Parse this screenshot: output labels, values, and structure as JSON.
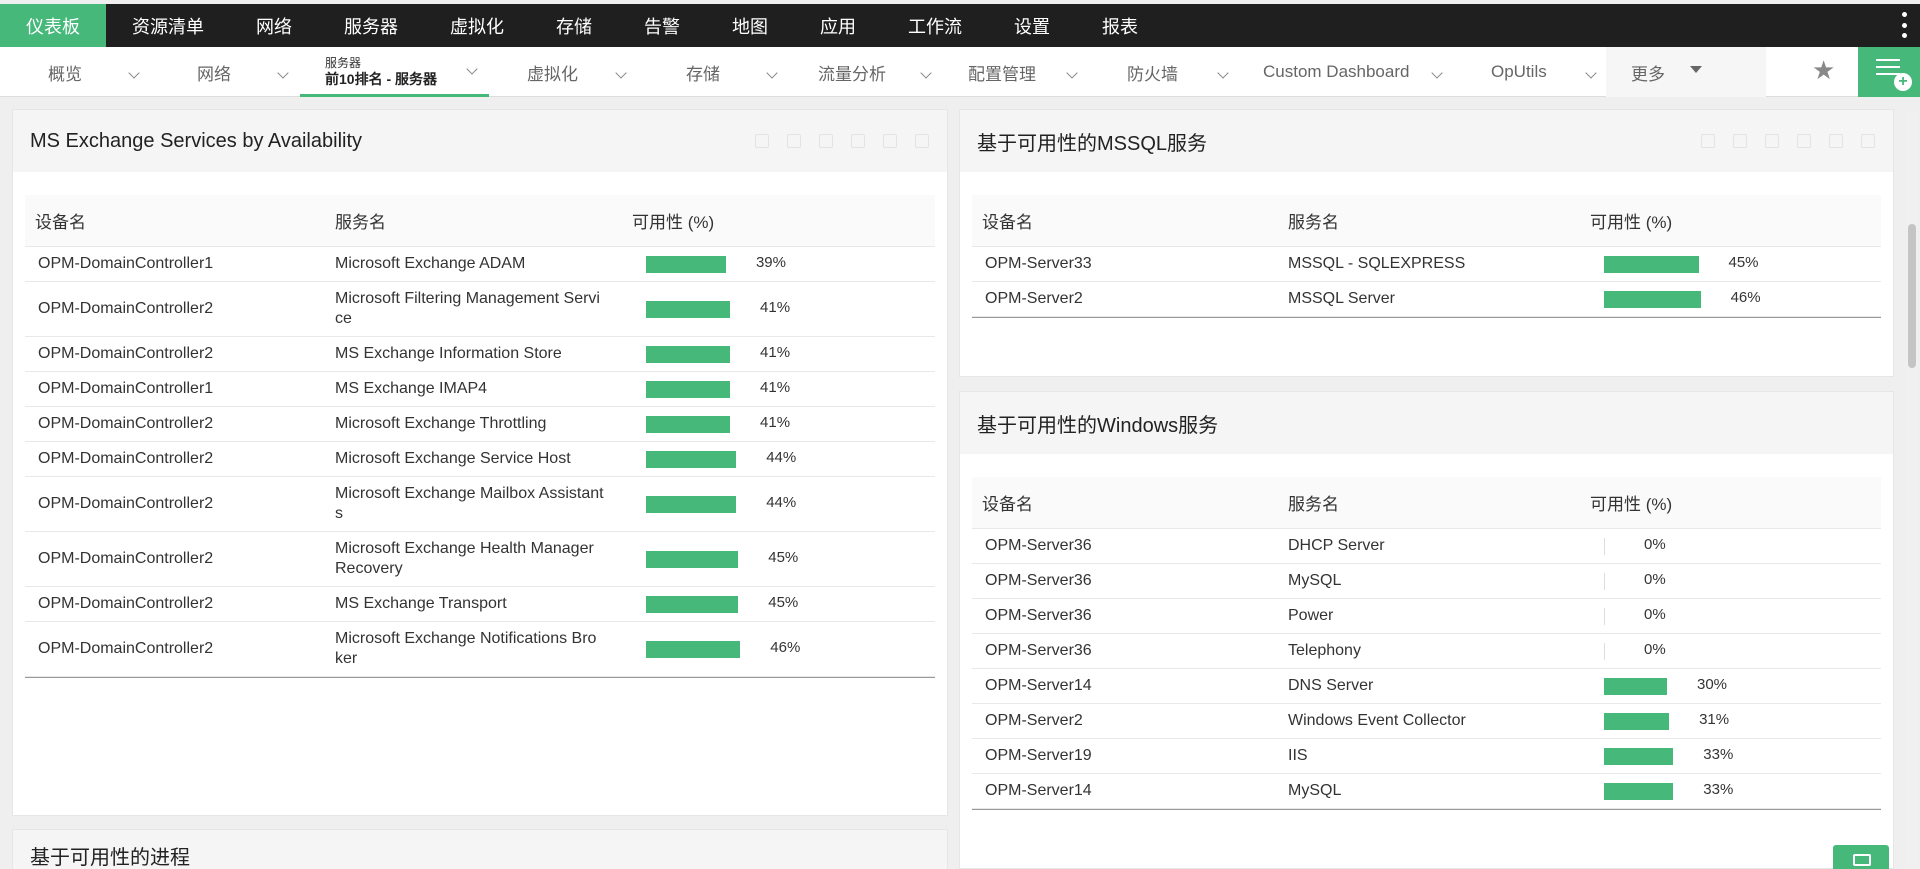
{
  "topnav": {
    "items": [
      "仪表板",
      "资源清单",
      "网络",
      "服务器",
      "虚拟化",
      "存储",
      "告警",
      "地图",
      "应用",
      "工作流",
      "设置",
      "报表"
    ]
  },
  "subnav": {
    "tabs": [
      "概览",
      "网络",
      "虚拟化",
      "存储",
      "流量分析",
      "配置管理",
      "防火墙",
      "Custom Dashboard",
      "OpUtils",
      "更多"
    ],
    "active_small": "服务器",
    "active_big": "前10排名 - 服务器"
  },
  "exchange": {
    "title": "MS Exchange Services by Availability",
    "headers": [
      "设备名",
      "服务名",
      "可用性 (%)"
    ],
    "rows": [
      {
        "device": "OPM-DomainController1",
        "service": "Microsoft Exchange ADAM",
        "service2": "",
        "value": 39,
        "pct": "39%"
      },
      {
        "device": "OPM-DomainController2",
        "service": "Microsoft Filtering Management Servi",
        "service2": "ce",
        "value": 41,
        "pct": "41%"
      },
      {
        "device": "OPM-DomainController2",
        "service": "MS Exchange Information Store",
        "service2": "",
        "value": 41,
        "pct": "41%"
      },
      {
        "device": "OPM-DomainController1",
        "service": "MS Exchange IMAP4",
        "service2": "",
        "value": 41,
        "pct": "41%"
      },
      {
        "device": "OPM-DomainController2",
        "service": "Microsoft Exchange Throttling",
        "service2": "",
        "value": 41,
        "pct": "41%"
      },
      {
        "device": "OPM-DomainController2",
        "service": "Microsoft Exchange Service Host",
        "service2": "",
        "value": 44,
        "pct": "44%"
      },
      {
        "device": "OPM-DomainController2",
        "service": "Microsoft Exchange Mailbox Assistant",
        "service2": "s",
        "value": 44,
        "pct": "44%"
      },
      {
        "device": "OPM-DomainController2",
        "service": "Microsoft Exchange Health Manager",
        "service2": "Recovery",
        "value": 45,
        "pct": "45%"
      },
      {
        "device": "OPM-DomainController2",
        "service": "MS Exchange Transport",
        "service2": "",
        "value": 45,
        "pct": "45%"
      },
      {
        "device": "OPM-DomainController2",
        "service": "Microsoft Exchange Notifications Bro",
        "service2": "ker",
        "value": 46,
        "pct": "46%"
      }
    ]
  },
  "mssql": {
    "title": "基于可用性的MSSQL服务",
    "headers": [
      "设备名",
      "服务名",
      "可用性 (%)"
    ],
    "rows": [
      {
        "device": "OPM-Server33",
        "service": "MSSQL - SQLEXPRESS",
        "service2": "",
        "value": 45,
        "pct": "45%"
      },
      {
        "device": "OPM-Server2",
        "service": "MSSQL Server",
        "service2": "",
        "value": 46,
        "pct": "46%"
      }
    ]
  },
  "windows": {
    "title": "基于可用性的Windows服务",
    "headers": [
      "设备名",
      "服务名",
      "可用性 (%)"
    ],
    "rows": [
      {
        "device": "OPM-Server36",
        "service": "DHCP Server",
        "service2": "",
        "value": 0,
        "pct": "0%"
      },
      {
        "device": "OPM-Server36",
        "service": "MySQL",
        "service2": "",
        "value": 0,
        "pct": "0%"
      },
      {
        "device": "OPM-Server36",
        "service": "Power",
        "service2": "",
        "value": 0,
        "pct": "0%"
      },
      {
        "device": "OPM-Server36",
        "service": "Telephony",
        "service2": "",
        "value": 0,
        "pct": "0%"
      },
      {
        "device": "OPM-Server14",
        "service": "DNS Server",
        "service2": "",
        "value": 30,
        "pct": "30%"
      },
      {
        "device": "OPM-Server2",
        "service": "Windows Event Collector",
        "service2": "",
        "value": 31,
        "pct": "31%"
      },
      {
        "device": "OPM-Server19",
        "service": "IIS",
        "service2": "",
        "value": 33,
        "pct": "33%"
      },
      {
        "device": "OPM-Server14",
        "service": "MySQL",
        "service2": "",
        "value": 33,
        "pct": "33%"
      }
    ]
  },
  "processes": {
    "title": "基于可用性的进程"
  },
  "colors": {
    "accent": "#45b87a",
    "topnav_bg": "#1f1f1f"
  }
}
